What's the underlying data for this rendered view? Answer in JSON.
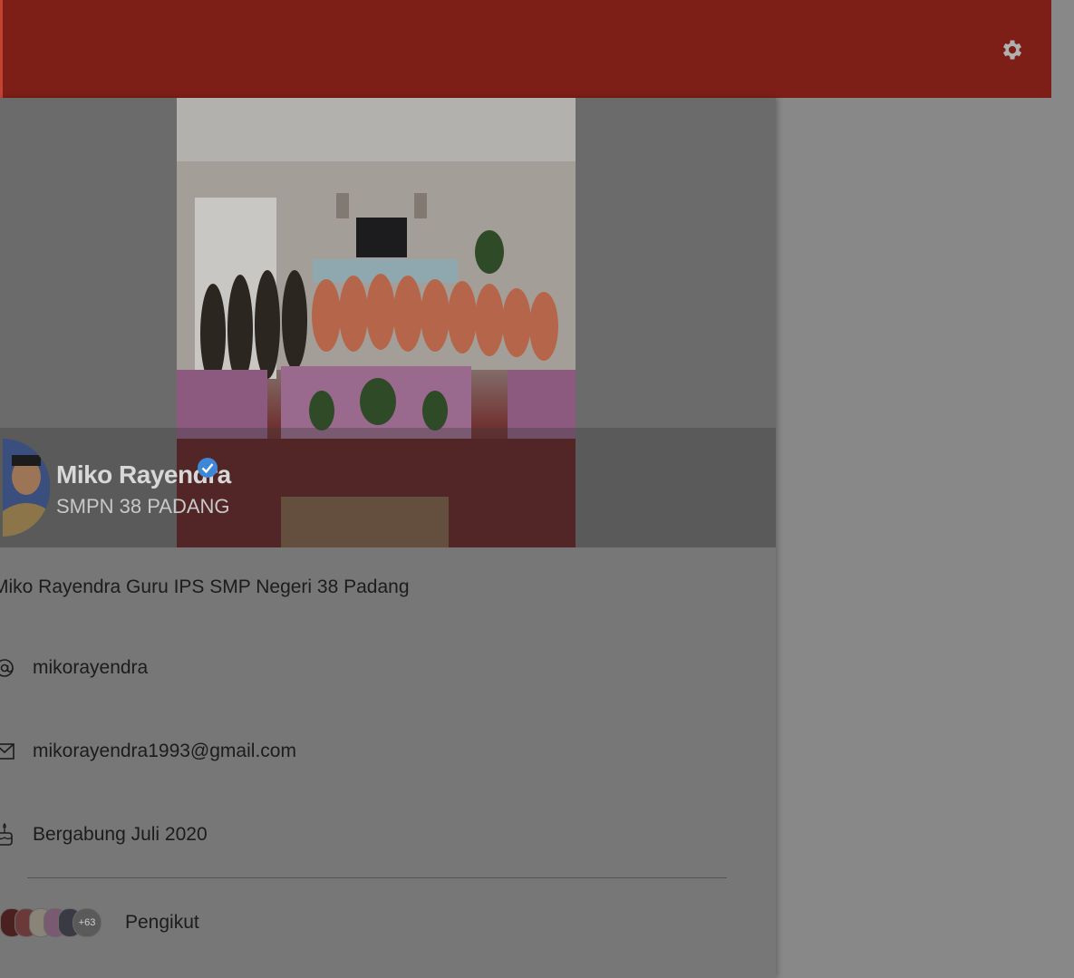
{
  "profile": {
    "name": "Miko Rayendra",
    "school": "SMPN 38 PADANG",
    "bio": "Miko Rayendra Guru IPS SMP Negeri 38 Padang",
    "username": "mikorayendra",
    "email": "mikorayendra1993@gmail.com",
    "joined": "Bergabung Juli 2020",
    "followers_extra": "+63",
    "followers_label": "Pengikut"
  },
  "icons": {
    "settings": "gear-icon",
    "verified": "verified-badge-icon",
    "username": "at-sign-icon",
    "email": "mail-icon",
    "joined": "cake-icon"
  },
  "colors": {
    "topbar": "#7d1f17",
    "overlay": "#888888",
    "verified": "#3e86d6"
  }
}
